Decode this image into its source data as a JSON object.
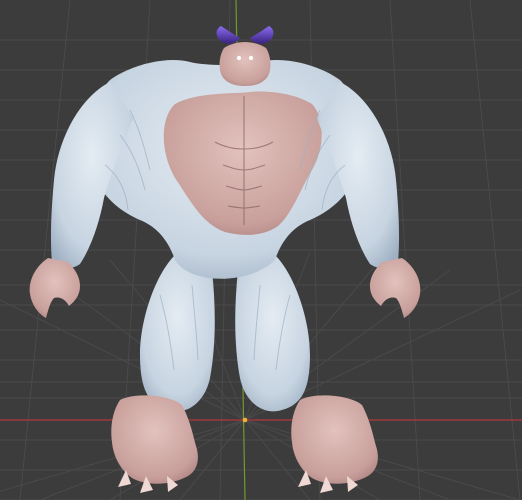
{
  "viewport": {
    "background_color": "#3c3c3c",
    "grid_color": "#4a4a4a",
    "x_axis_color": "#9b3a3a",
    "y_axis_color": "#6f9a2e",
    "origin_color": "#f2b233"
  },
  "model": {
    "fur_color": "#cfdbe6",
    "fur_shadow_color": "#9fb0c3",
    "skin_color": "#d8b3ae",
    "skin_shadow_color": "#a8807e",
    "horn_color": "#6b4bd1",
    "eye_color": "#ffffff"
  }
}
